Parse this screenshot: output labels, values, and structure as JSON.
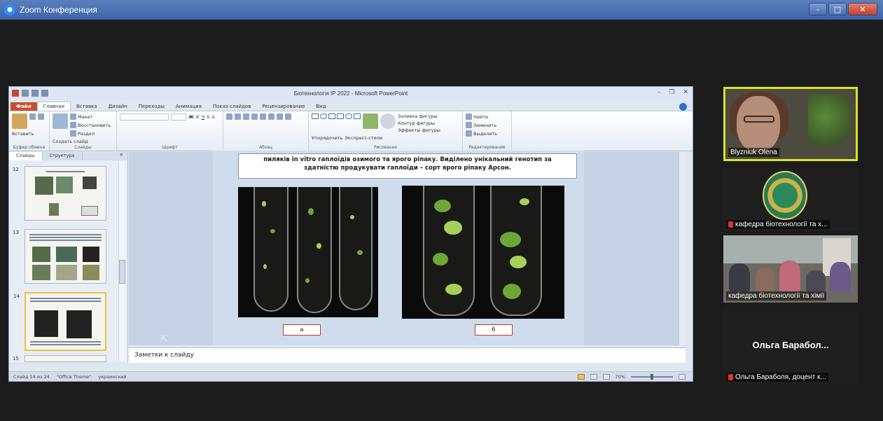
{
  "zoom": {
    "window_title": "Zoom Конференция"
  },
  "ppt": {
    "doc_title": "Біотехнологія ІР 2022 - Microsoft PowerPoint",
    "tabs": [
      "Файл",
      "Главная",
      "Вставка",
      "Дизайн",
      "Переходы",
      "Анимация",
      "Показ слайдов",
      "Рецензирование",
      "Вид"
    ],
    "ribbon": {
      "clipboard_paste": "Вставить",
      "clipboard_label": "Буфер обмена",
      "slides_new": "Создать слайд",
      "slides_layout": "Макет",
      "slides_reset": "Восстановить",
      "slides_section": "Раздел",
      "slides_label": "Слайды",
      "font_label": "Шрифт",
      "paragraph_label": "Абзац",
      "drawing_arrange": "Упорядочить",
      "drawing_styles": "Экспресс-стили",
      "drawing_fill": "Заливка фигуры",
      "drawing_outline": "Контур фигуры",
      "drawing_effects": "Эффекты фигуры",
      "drawing_label": "Рисование",
      "edit_find": "Найти",
      "edit_replace": "Заменить",
      "edit_select": "Выделить",
      "edit_label": "Редактирование"
    },
    "panel_tabs": [
      "Слайды",
      "Структура"
    ],
    "slide_numbers": [
      "12",
      "13",
      "14",
      "15"
    ],
    "slide_text_line1": "пиляків in vitro  гаплоїдів озимого та ярого ріпаку. Виділено унікальний генотип за",
    "slide_text_line2": "здатністю продукувати гаплоїди – сорт ярого ріпаку Арсон.",
    "label_a": "а",
    "label_b": "б",
    "notes": "Заметки к слайду",
    "status_slide": "Слайд 14 из 24",
    "status_theme": "\"Office Theme\"",
    "status_lang": "украинский",
    "status_zoom": "70%"
  },
  "participants": [
    {
      "name": "Blyzniuk Olena",
      "muted": false
    },
    {
      "name": "кафедра біотехнології та х...",
      "muted": true
    },
    {
      "name": "кафедра біотехнології та хімії",
      "muted": false
    },
    {
      "name": "Ольга Бараболя, доцент к...",
      "muted": true,
      "display": "Ольга Барабол..."
    }
  ],
  "colors": {
    "active_speaker": "#d8e22a",
    "ppt_file_tab": "#c5512c",
    "muted_mic": "#d9362b"
  }
}
